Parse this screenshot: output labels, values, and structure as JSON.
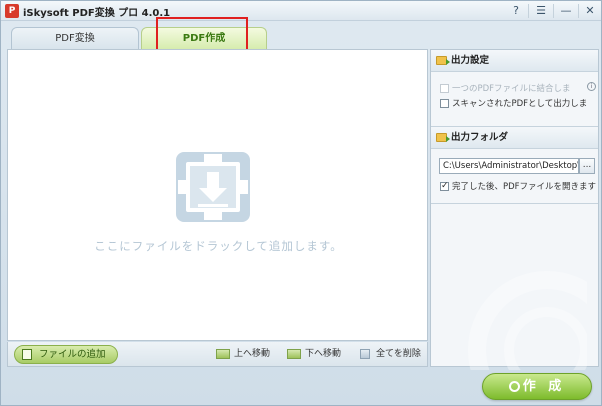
{
  "window": {
    "title": "iSkysoft PDF変換 プロ  4.0.1",
    "icon_letter": "P"
  },
  "titlebar_buttons": {
    "help": "?",
    "register": "☰",
    "minimize": "—",
    "close": "✕"
  },
  "tabs": [
    {
      "label": "PDF変換",
      "active": false
    },
    {
      "label": "PDF作成",
      "active": true
    }
  ],
  "droparea": {
    "hint": "ここにファイルをドラックして追加します。"
  },
  "bottombar": {
    "add_file": "ファイルの追加",
    "move_up": "上へ移動",
    "move_down": "下へ移動",
    "delete_all": "全てを削除"
  },
  "output_settings": {
    "title": "出力設定",
    "merge_option": {
      "label": "一つのPDFファイルに結合しま",
      "checked": false,
      "enabled": false
    },
    "scanned_option": {
      "label": "スキャンされたPDFとして出力しま",
      "checked": false,
      "enabled": true
    }
  },
  "output_folder": {
    "title": "出力フォルダ",
    "path": "C:\\Users\\Administrator\\Desktop\\",
    "browse": "...",
    "open_after": {
      "label": "完了した後、PDFファイルを開きます",
      "checked": true
    }
  },
  "create_button": {
    "label": "作 成"
  },
  "colors": {
    "accent_green": "#7dbb2c",
    "highlight_red": "#e02020"
  }
}
